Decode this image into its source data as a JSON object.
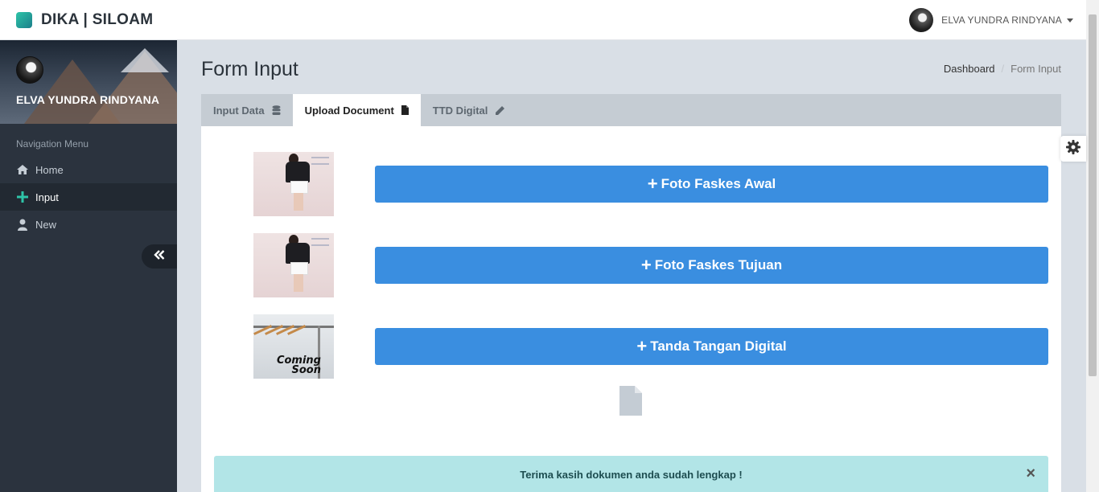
{
  "app": {
    "brand": "DIKA | SILOAM"
  },
  "topbar": {
    "user_name": "ELVA YUNDRA RINDYANA"
  },
  "sidebar": {
    "user_name": "ELVA YUNDRA RINDYANA",
    "nav_title": "Navigation Menu",
    "items": [
      {
        "label": "Home",
        "icon": "home-icon"
      },
      {
        "label": "Input",
        "icon": "plus-icon",
        "active": true
      },
      {
        "label": "New",
        "icon": "user-icon"
      }
    ]
  },
  "page": {
    "title": "Form Input",
    "breadcrumb": [
      "Dashboard",
      "Form Input"
    ]
  },
  "tabs": [
    {
      "label": "Input Data",
      "icon": "database-icon"
    },
    {
      "label": "Upload Document",
      "icon": "file-icon",
      "active": true
    },
    {
      "label": "TTD Digital",
      "icon": "pencil-icon"
    }
  ],
  "uploads": [
    {
      "button": "Foto Faskes Awal",
      "image": "person-photo"
    },
    {
      "button": "Foto Faskes Tujuan",
      "image": "person-photo"
    },
    {
      "button": "Tanda Tangan Digital",
      "image": "coming-soon",
      "image_text_1": "Coming",
      "image_text_2": "Soon"
    }
  ],
  "alert": {
    "message": "Terima kasih dokumen anda sudah lengkap !",
    "close": "×"
  },
  "colors": {
    "primary": "#3a8ee0",
    "sidebar": "#2b333e",
    "alert_bg": "#b2e5e7",
    "accent": "#2ec4a8"
  }
}
